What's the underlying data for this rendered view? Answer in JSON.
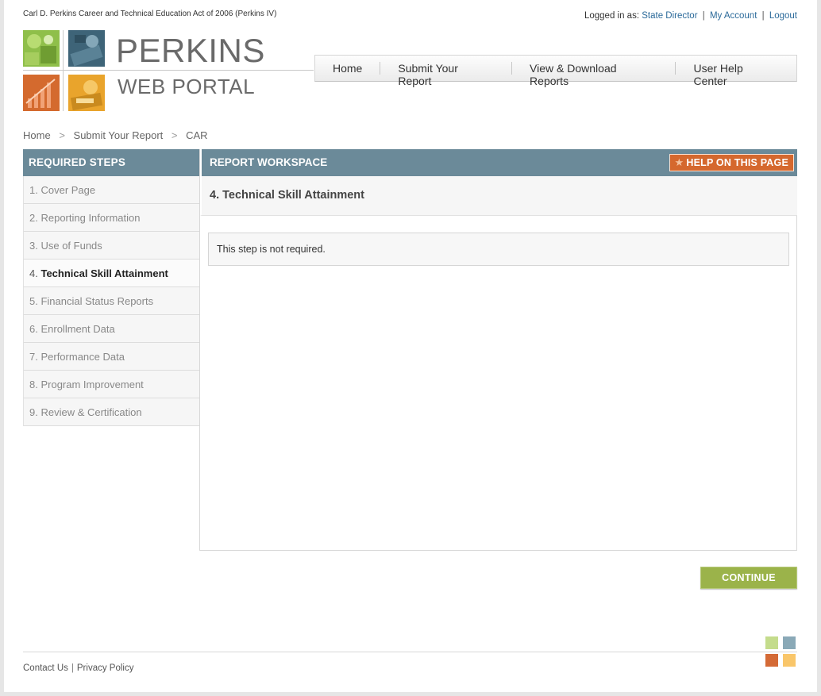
{
  "header": {
    "act_title": "Carl D. Perkins Career and Technical Education Act of 2006 (Perkins IV)",
    "logged_in_label": "Logged in as:",
    "user_role": "State Director",
    "account_link": "My Account",
    "logout_link": "Logout",
    "separator": "|"
  },
  "logo": {
    "line1": "PERKINS",
    "line2": "WEB PORTAL"
  },
  "nav": {
    "items": [
      {
        "label": "Home"
      },
      {
        "label": "Submit Your Report"
      },
      {
        "label": "View & Download Reports"
      },
      {
        "label": "User Help Center"
      }
    ]
  },
  "breadcrumb": {
    "items": [
      "Home",
      "Submit Your Report",
      "CAR"
    ],
    "separator": ">"
  },
  "steps": {
    "heading": "REQUIRED STEPS",
    "items": [
      {
        "num": "1.",
        "label": "Cover Page"
      },
      {
        "num": "2.",
        "label": "Reporting Information"
      },
      {
        "num": "3.",
        "label": "Use of Funds"
      },
      {
        "num": "4.",
        "label": "Technical Skill Attainment"
      },
      {
        "num": "5.",
        "label": "Financial Status Reports"
      },
      {
        "num": "6.",
        "label": "Enrollment Data"
      },
      {
        "num": "7.",
        "label": "Performance Data"
      },
      {
        "num": "8.",
        "label": "Program Improvement"
      },
      {
        "num": "9.",
        "label": "Review & Certification"
      }
    ],
    "active_index": 3
  },
  "workspace": {
    "heading": "REPORT WORKSPACE",
    "help_button": "HELP ON THIS PAGE",
    "title": "4. Technical Skill Attainment",
    "message": "This step is not required."
  },
  "actions": {
    "continue_label": "CONTINUE"
  },
  "footer": {
    "contact_link": "Contact Us",
    "privacy_link": "Privacy Policy",
    "separator": "|"
  },
  "colors": {
    "panel_header": "#6b8a99",
    "help_orange": "#d5682e",
    "continue_green": "#9bb34a",
    "link_blue": "#2b6a9a"
  }
}
